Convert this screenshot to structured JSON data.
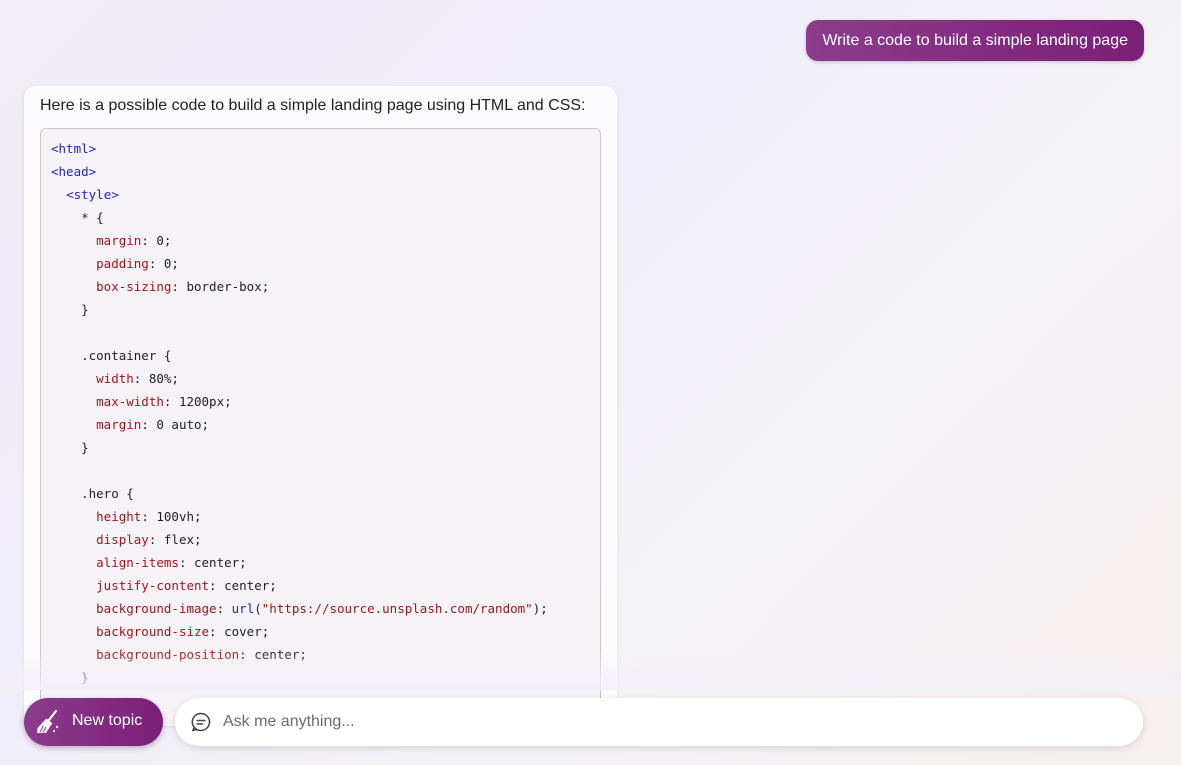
{
  "conversation": {
    "user_message": "Write a code to build a simple landing page",
    "bot_intro": "Here is a possible code to build a simple landing page using HTML and CSS:",
    "code_lines": [
      [
        {
          "t": "<html>",
          "c": "tag"
        }
      ],
      [
        {
          "t": "<head>",
          "c": "tag"
        }
      ],
      [
        {
          "t": "  "
        },
        {
          "t": "<style>",
          "c": "tag"
        }
      ],
      [
        {
          "t": "    * {"
        }
      ],
      [
        {
          "t": "      "
        },
        {
          "t": "margin",
          "c": "prop"
        },
        {
          "t": ": 0;"
        }
      ],
      [
        {
          "t": "      "
        },
        {
          "t": "padding",
          "c": "prop"
        },
        {
          "t": ": 0;"
        }
      ],
      [
        {
          "t": "      "
        },
        {
          "t": "box-sizing",
          "c": "prop"
        },
        {
          "t": ": border-box;"
        }
      ],
      [
        {
          "t": "    }"
        }
      ],
      [
        {
          "t": ""
        }
      ],
      [
        {
          "t": "    .container {"
        }
      ],
      [
        {
          "t": "      "
        },
        {
          "t": "width",
          "c": "prop"
        },
        {
          "t": ": 80%;"
        }
      ],
      [
        {
          "t": "      "
        },
        {
          "t": "max-width",
          "c": "prop"
        },
        {
          "t": ": 1200px;"
        }
      ],
      [
        {
          "t": "      "
        },
        {
          "t": "margin",
          "c": "prop"
        },
        {
          "t": ": 0 auto;"
        }
      ],
      [
        {
          "t": "    }"
        }
      ],
      [
        {
          "t": ""
        }
      ],
      [
        {
          "t": "    .hero {"
        }
      ],
      [
        {
          "t": "      "
        },
        {
          "t": "height",
          "c": "prop"
        },
        {
          "t": ": 100vh;"
        }
      ],
      [
        {
          "t": "      "
        },
        {
          "t": "display",
          "c": "prop"
        },
        {
          "t": ": flex;"
        }
      ],
      [
        {
          "t": "      "
        },
        {
          "t": "align-items",
          "c": "prop"
        },
        {
          "t": ": center;"
        }
      ],
      [
        {
          "t": "      "
        },
        {
          "t": "justify-content",
          "c": "prop"
        },
        {
          "t": ": center;"
        }
      ],
      [
        {
          "t": "      "
        },
        {
          "t": "background-image",
          "c": "prop"
        },
        {
          "t": ": "
        },
        {
          "t": "url",
          "c": "fn"
        },
        {
          "t": "("
        },
        {
          "t": "\"https://source.unsplash.com/random\"",
          "c": "str"
        },
        {
          "t": ");"
        }
      ],
      [
        {
          "t": "      "
        },
        {
          "t": "background-size",
          "c": "prop"
        },
        {
          "t": ": cover;"
        }
      ],
      [
        {
          "t": "      "
        },
        {
          "t": "background-position",
          "c": "prop"
        },
        {
          "t": ": center;"
        }
      ],
      [
        {
          "t": "    }"
        }
      ]
    ]
  },
  "composer": {
    "new_topic_label": "New topic",
    "new_topic_icon": "broom-icon",
    "chat_icon": "chat-bubble-icon",
    "input_value": "",
    "input_placeholder": "Ask me anything..."
  },
  "colors": {
    "accent_start": "#8c3c8c",
    "accent_end": "#7a1f78",
    "code_tag": "#2222c8",
    "code_property": "#a31515"
  }
}
